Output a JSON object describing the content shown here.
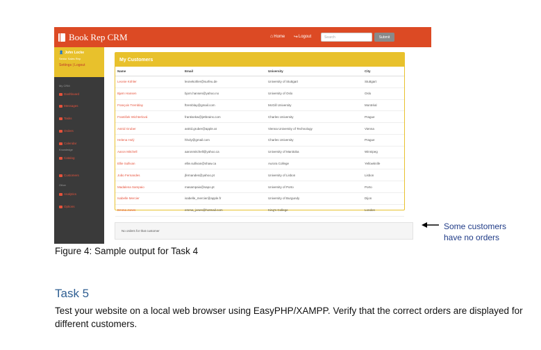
{
  "app": {
    "brand": "Book Rep CRM",
    "nav_home": "Home",
    "nav_logout": "Logout",
    "search_placeholder": "Search",
    "submit_label": "Submit",
    "accent_color": "#dc4a24",
    "highlight_color": "#e8c12c"
  },
  "sidebar": {
    "user_name": "John Locke",
    "user_role": "Senior Sales Rep",
    "settings_link": "Settings",
    "logout_link": "Logout",
    "section_mycrm": "My CRM",
    "section_knowledge": "Knowledge",
    "section_other": "Other",
    "items": [
      {
        "label": "Dashboard",
        "icon": "dashboard-icon"
      },
      {
        "label": "Messages",
        "icon": "messages-icon"
      },
      {
        "label": "Tasks",
        "icon": "tasks-icon"
      },
      {
        "label": "Orders",
        "icon": "orders-icon"
      },
      {
        "label": "Calendar",
        "icon": "calendar-icon"
      },
      {
        "label": "Catalog",
        "icon": "catalog-icon"
      },
      {
        "label": "Customers",
        "icon": "customers-icon"
      },
      {
        "label": "Analytics",
        "icon": "analytics-icon"
      },
      {
        "label": "Options",
        "icon": "options-icon"
      }
    ]
  },
  "customers": {
    "title": "My Customers",
    "columns": [
      "Name",
      "Email",
      "University",
      "City"
    ],
    "rows": [
      [
        "Leonie Köhler",
        "leonekohler@surfeu.de",
        "University of Stuttgart",
        "Stuttgart"
      ],
      [
        "Bjørn Hansen",
        "bjorn.hansen@yahoo.no",
        "University of Oslo",
        "Oslo"
      ],
      [
        "François Tremblay",
        "ftremblay@gmail.com",
        "McGill University",
        "Montréal"
      ],
      [
        "František Wichterlová",
        "frantisekw@jetbrains.com",
        "Charles University",
        "Prague"
      ],
      [
        "Astrid Gruber",
        "astrid.gruber@apple.at",
        "Vienna University of Technology",
        "Vienna"
      ],
      [
        "Helena Holý",
        "hholy@gmail.com",
        "Charles University",
        "Prague"
      ],
      [
        "Aaron Mitchell",
        "aaronmitchell@yahoo.ca",
        "University of Manitoba",
        "Winnipeg"
      ],
      [
        "Ellie Sullivan",
        "ellie.sullivan@shaw.ca",
        "Aurora College",
        "Yellowknife"
      ],
      [
        "João Fernandes",
        "jfernandes@yahoo.pt",
        "University of Lisbon",
        "Lisbon"
      ],
      [
        "Madalena Sampaio",
        "masampaio@sapo.pt",
        "University of Porto",
        "Porto"
      ],
      [
        "Isabelle Mercier",
        "isabelle_mercier@apple.fr",
        "University of Burgundy",
        "Dijon"
      ],
      [
        "Emma Jones",
        "emma_jones@hotmail.com",
        "King's College",
        "London"
      ]
    ]
  },
  "orders_message": "No orders for that customer",
  "annotation": {
    "line1": "Some customers",
    "line2": "have no orders"
  },
  "caption": "Figure 4: Sample output for Task 4",
  "task": {
    "heading": "Task 5",
    "body": "Test your website on a local web browser using EasyPHP/XAMPP.  Verify that the correct orders are displayed for different customers."
  }
}
